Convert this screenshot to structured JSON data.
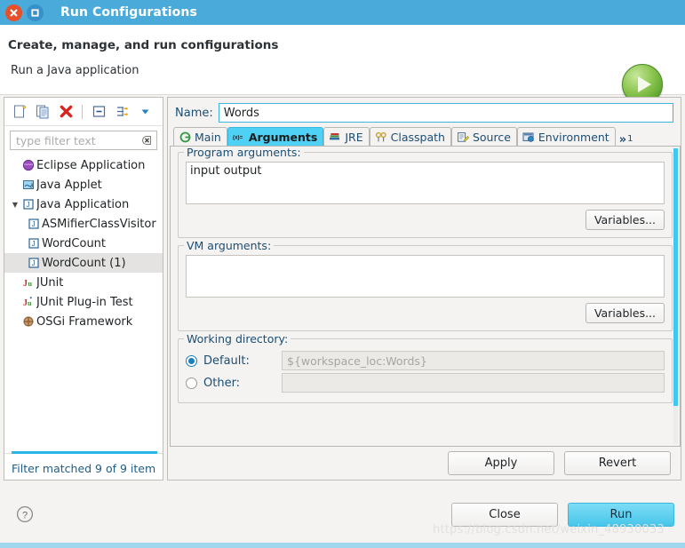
{
  "window": {
    "title": "Run Configurations",
    "close_icon": "close-icon",
    "maximize_icon": "maximize-icon"
  },
  "header": {
    "title": "Create, manage, and run configurations",
    "subtitle": "Run a Java application",
    "badge_icon": "run-play-icon"
  },
  "toolbar": {
    "items": [
      {
        "name": "new-configuration-icon",
        "label": "New launch configuration"
      },
      {
        "name": "duplicate-configuration-icon",
        "label": "Duplicate"
      },
      {
        "name": "delete-configuration-icon",
        "label": "Delete"
      },
      {
        "name": "collapse-all-icon",
        "label": "Collapse All"
      },
      {
        "name": "filter-icon",
        "label": "Filter"
      },
      {
        "name": "view-menu-icon",
        "label": "View Menu"
      }
    ]
  },
  "filter": {
    "placeholder": "type filter text",
    "value": "",
    "clear_icon": "clear-icon"
  },
  "tree": {
    "items": [
      {
        "label": "Eclipse Application",
        "icon": "eclipse-application-icon",
        "indent": 0,
        "expander": "",
        "selected": false
      },
      {
        "label": "Java Applet",
        "icon": "java-applet-icon",
        "indent": 0,
        "expander": "",
        "selected": false
      },
      {
        "label": "Java Application",
        "icon": "java-application-icon",
        "indent": 0,
        "expander": "▼",
        "selected": false
      },
      {
        "label": "ASMifierClassVisitor",
        "icon": "java-launch-icon",
        "indent": 1,
        "expander": "",
        "selected": false
      },
      {
        "label": "WordCount",
        "icon": "java-launch-icon",
        "indent": 1,
        "expander": "",
        "selected": false
      },
      {
        "label": "WordCount (1)",
        "icon": "java-launch-icon",
        "indent": 1,
        "expander": "",
        "selected": true
      },
      {
        "label": "JUnit",
        "icon": "junit-icon",
        "indent": 0,
        "expander": "",
        "selected": false
      },
      {
        "label": "JUnit Plug-in Test",
        "icon": "junit-plugin-icon",
        "indent": 0,
        "expander": "",
        "selected": false
      },
      {
        "label": "OSGi Framework",
        "icon": "osgi-icon",
        "indent": 0,
        "expander": "",
        "selected": false
      }
    ],
    "status": "Filter matched 9 of 9 item"
  },
  "config": {
    "name_label": "Name:",
    "name_value": "Words"
  },
  "tabs": [
    {
      "label": "Main",
      "icon": "main-tab-icon",
      "active": false
    },
    {
      "label": "Arguments",
      "icon": "arguments-tab-icon",
      "active": true
    },
    {
      "label": "JRE",
      "icon": "jre-tab-icon",
      "active": false
    },
    {
      "label": "Classpath",
      "icon": "classpath-tab-icon",
      "active": false
    },
    {
      "label": "Source",
      "icon": "source-tab-icon",
      "active": false
    },
    {
      "label": "Environment",
      "icon": "environment-tab-icon",
      "active": false
    }
  ],
  "tab_overflow": {
    "chevron": "»",
    "count": "1"
  },
  "arguments_tab": {
    "program_args": {
      "legend": "Program arguments:",
      "value": "input output",
      "variables_button": "Variables..."
    },
    "vm_args": {
      "legend": "VM arguments:",
      "value": "",
      "variables_button": "Variables..."
    },
    "working_directory": {
      "legend": "Working directory:",
      "default_label": "Default:",
      "default_value": "${workspace_loc:Words}",
      "default_selected": true,
      "other_label": "Other:",
      "other_value": "",
      "other_selected": false
    }
  },
  "actions": {
    "apply": "Apply",
    "revert": "Revert",
    "close": "Close",
    "run": "Run",
    "help_icon": "help-icon"
  },
  "watermark": "https://blog.csdn.net/weixin_48930033",
  "colors": {
    "titlebar": "#4aabda",
    "accent": "#4fd1f5",
    "close_button": "#e8502a",
    "link_text": "#1b4e73",
    "run_button": "#47c6ea"
  }
}
